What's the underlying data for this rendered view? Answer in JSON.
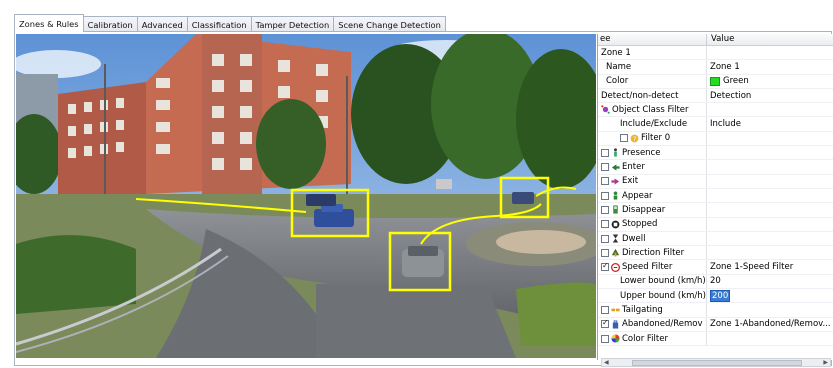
{
  "tabs": [
    {
      "label": "Zones & Rules",
      "active": true
    },
    {
      "label": "Calibration",
      "active": false
    },
    {
      "label": "Advanced",
      "active": false
    },
    {
      "label": "Classification",
      "active": false
    },
    {
      "label": "Tamper Detection",
      "active": false
    },
    {
      "label": "Scene Change Detection",
      "active": false
    }
  ],
  "grid": {
    "header_name": "ee",
    "header_value": "Value",
    "rows": [
      {
        "name": "Zone 1",
        "value": ""
      },
      {
        "name": "Name",
        "value": "Zone 1"
      },
      {
        "name": "Color",
        "value": "Green"
      },
      {
        "name": "Detect/non-detect",
        "value": "Detection"
      },
      {
        "name": "Object Class Filter",
        "value": ""
      },
      {
        "name": "Include/Exclude",
        "value": "Include"
      },
      {
        "name": "Filter 0",
        "value": ""
      },
      {
        "name": "Presence",
        "value": ""
      },
      {
        "name": "Enter",
        "value": ""
      },
      {
        "name": "Exit",
        "value": ""
      },
      {
        "name": "Appear",
        "value": ""
      },
      {
        "name": "Disappear",
        "value": ""
      },
      {
        "name": "Stopped",
        "value": ""
      },
      {
        "name": "Dwell",
        "value": ""
      },
      {
        "name": "Direction Filter",
        "value": ""
      },
      {
        "name": "Speed Filter",
        "value": "Zone 1-Speed Filter"
      },
      {
        "name": "Lower bound (km/h)",
        "value": "20"
      },
      {
        "name": "Upper bound (km/h)",
        "value": "200"
      },
      {
        "name": "Tailgating",
        "value": ""
      },
      {
        "name": "Abandoned/Remov",
        "value": "Zone 1-Abandoned/Remov..."
      },
      {
        "name": "Color Filter",
        "value": ""
      }
    ]
  },
  "colors": {
    "zone_color": "#22dd22",
    "detection_box": "#ffff00",
    "selection": "#3a7bd5"
  },
  "icons": {
    "object_class_filter": "object-class-icon",
    "filter_0": "question-icon",
    "presence": "person-icon",
    "enter": "enter-arrow-icon",
    "exit": "exit-arrow-icon",
    "appear": "appear-icon",
    "disappear": "disappear-icon",
    "stopped": "stop-icon",
    "dwell": "hourglass-icon",
    "direction_filter": "direction-icon",
    "speed_filter": "speed-icon",
    "tailgating": "tailgating-icon",
    "abandoned": "abandoned-icon",
    "color_filter": "color-wheel-icon"
  }
}
